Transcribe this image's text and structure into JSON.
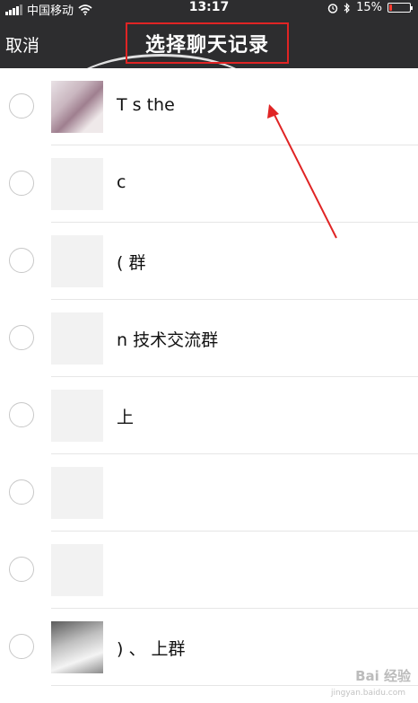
{
  "status_bar": {
    "carrier": "中国移动",
    "time": "13:17",
    "battery": "15%",
    "battery_level": 0.15
  },
  "nav": {
    "cancel": "取消",
    "title": "选择聊天记录"
  },
  "list": {
    "items": [
      {
        "label": "T    s the"
      },
      {
        "label": "         c"
      },
      {
        "label": "    (    群"
      },
      {
        "label": "       n    技术交流群"
      },
      {
        "label": "      上"
      },
      {
        "label": ""
      },
      {
        "label": ""
      },
      {
        "label": "  )  、  上群"
      }
    ]
  },
  "watermark": {
    "brand": "Bai 经验",
    "url": "jingyan.baidu.com"
  },
  "colors": {
    "bar_bg": "#2d2d2f",
    "highlight_red": "#e02424",
    "battery_red": "#ff3b30"
  }
}
